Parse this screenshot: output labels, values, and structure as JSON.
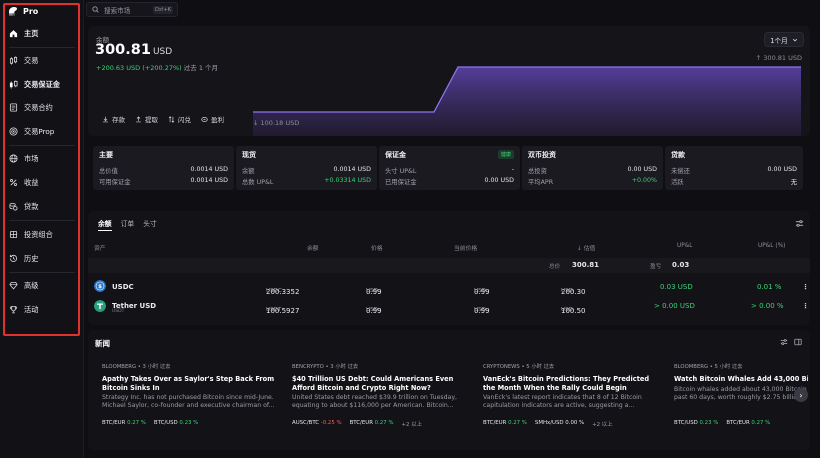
{
  "brand": {
    "label": "Pro"
  },
  "sidebar": {
    "items": [
      {
        "label": "主页",
        "icon": "home-icon"
      },
      {
        "label": "交易",
        "icon": "candles-icon"
      },
      {
        "label": "交易保证金",
        "icon": "margin-icon"
      },
      {
        "label": "交易合约",
        "icon": "contract-icon"
      },
      {
        "label": "交易Prop",
        "icon": "target-icon"
      },
      {
        "label": "市场",
        "icon": "globe-icon"
      },
      {
        "label": "收益",
        "icon": "percent-icon"
      },
      {
        "label": "贷款",
        "icon": "coins-icon"
      },
      {
        "label": "投资组合",
        "icon": "portfolio-icon"
      },
      {
        "label": "历史",
        "icon": "history-icon"
      },
      {
        "label": "高级",
        "icon": "diamond-icon"
      },
      {
        "label": "活动",
        "icon": "trophy-icon"
      }
    ],
    "highlight_color": "#e0312e"
  },
  "search": {
    "placeholder": "搜索市场",
    "shortcut": "Ctrl+K"
  },
  "balance": {
    "label": "余额",
    "value": "300.81",
    "currency": "USD",
    "change_amount": "+200.63 USD",
    "change_pct": "(+200.27%)",
    "change_period": "过去 1 个月",
    "period_select": "1个月",
    "chart_max": "↑ 300.81 USD",
    "chart_min": "↓ 100.18 USD",
    "actions": [
      "存款",
      "提取",
      "闪兑",
      "盈利"
    ]
  },
  "chart_data": {
    "type": "area",
    "series": [
      {
        "values": [
          100.18,
          100.18,
          100.18,
          300.81,
          300.81
        ]
      }
    ],
    "ylim": [
      100.18,
      300.81
    ],
    "grid": false
  },
  "cards": [
    {
      "title": "主要",
      "rows": [
        {
          "k": "总价值",
          "v": "0.0014 USD"
        },
        {
          "k": "可用保证金",
          "v": "0.0014 USD"
        }
      ]
    },
    {
      "title": "现货",
      "rows": [
        {
          "k": "余额",
          "v": "0.0014 USD"
        },
        {
          "k": "总数 UP&L",
          "v": "+0.03314 USD"
        }
      ]
    },
    {
      "title": "保证金",
      "badge": "健康",
      "rows": [
        {
          "k": "头寸 UP&L",
          "v": "-"
        },
        {
          "k": "已用保证金",
          "v": "0.00 USD"
        }
      ]
    },
    {
      "title": "双币投资",
      "rows": [
        {
          "k": "总投资",
          "v": "0.00 USD"
        },
        {
          "k": "平均APR",
          "v": "+0.00%"
        }
      ]
    },
    {
      "title": "贷款",
      "rows": [
        {
          "k": "未偿还",
          "v": "0.00 USD"
        },
        {
          "k": "活跃",
          "v": "无"
        }
      ]
    }
  ],
  "holdings": {
    "tabs": [
      "余额",
      "订单",
      "头寸"
    ],
    "columns": [
      "资产",
      "余额",
      "价格",
      "当前价格",
      "↓ 估值",
      "UP&L",
      "UP&L (%)"
    ],
    "total": {
      "label": "总价",
      "value": "300.81",
      "upl_label": "盈亏",
      "upl": "0.03"
    },
    "rows": [
      {
        "symbol": "USDC",
        "balance": "200.3352",
        "balance_unit": "USDC",
        "price": "0.99",
        "price_unit": "USD",
        "current": "0.99",
        "current_unit": "USD",
        "value": "200.30",
        "value_unit": "USD",
        "upl": "0.03 USD",
        "upl_pct": "0.01 %",
        "sub": ""
      },
      {
        "symbol": "Tether USD",
        "balance": "100.5927",
        "balance_unit": "USDT",
        "price": "0.99",
        "price_unit": "USD",
        "current": "0.99",
        "current_unit": "USD",
        "value": "100.50",
        "value_unit": "USD",
        "upl": "> 0.00 USD",
        "upl_pct": "> 0.00 %",
        "sub": "USDT"
      }
    ]
  },
  "news": {
    "title": "新闻",
    "items": [
      {
        "source": "BLOOMBERG • 3 小时 过去",
        "headline": "Apathy Takes Over as Saylor's Step Back From Bitcoin Sinks In",
        "body": "Strategy Inc. has not purchased Bitcoin since mid-June. Michael Saylor, co-founder and executive chairman of...",
        "tags": [
          {
            "s": "BTC/EUR",
            "c": "0.27 %",
            "t": "pos"
          },
          {
            "s": "BTC/USD",
            "c": "0.23 %",
            "t": "pos"
          }
        ]
      },
      {
        "source": "BENCRYPTO • 3 小时 过去",
        "headline": "$40 Trillion US Debt: Could Americans Even Afford Bitcoin and Crypto Right Now?",
        "body": "United States debt reached $39.9 trillion on Tuesday, equating to about $116,000 per American. Bitcoin...",
        "tags": [
          {
            "s": "AUSC/BTC",
            "c": "-0.25 %",
            "t": "neg"
          },
          {
            "s": "BTC/EUR",
            "c": "0.27 %",
            "t": "pos"
          },
          {
            "s": "+2 以上",
            "c": "",
            "t": "more"
          }
        ]
      },
      {
        "source": "CRYPTONEWS • 5 小时 过去",
        "headline": "VanEck's Bitcoin Predictions: They Predicted the Month When the Rally Could Begin",
        "body": "VanEck's latest report indicates that 8 of 12 Bitcoin capitulation indicators are active, suggesting a...",
        "tags": [
          {
            "s": "BTC/EUR",
            "c": "0.27 %",
            "t": "pos"
          },
          {
            "s": "SMHx/USD",
            "c": "0.00 %",
            "t": "flat"
          },
          {
            "s": "+2 以上",
            "c": "",
            "t": "more"
          }
        ]
      },
      {
        "source": "BLOOMBERG • 5 小时 过去",
        "headline": "Watch Bitcoin Whales Add 43,000 Bitcoin",
        "body": "Bitcoin whales added about 43,000 Bitcoin past 60 days, worth roughly $2.75 billion...",
        "tags": [
          {
            "s": "BTC/USD",
            "c": "0.23 %",
            "t": "pos"
          },
          {
            "s": "BTC/EUR",
            "c": "0.27 %",
            "t": "pos"
          }
        ]
      }
    ]
  }
}
